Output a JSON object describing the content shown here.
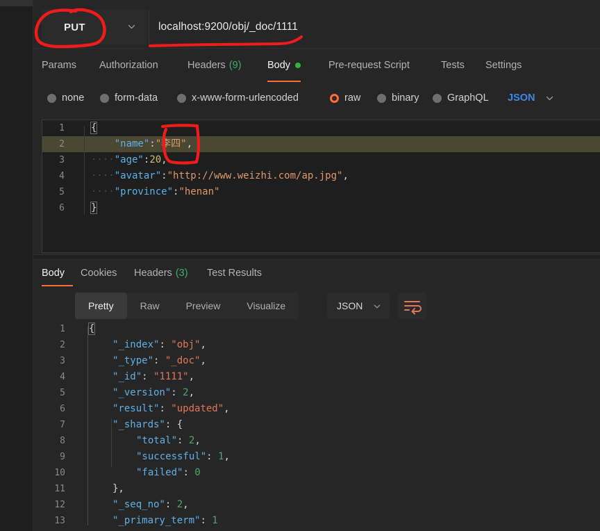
{
  "request": {
    "method": "PUT",
    "url": "localhost:9200/obj/_doc/1111",
    "tabs": [
      {
        "label": "Params",
        "count": null,
        "dot": false,
        "active": false
      },
      {
        "label": "Authorization",
        "count": null,
        "dot": false,
        "active": false
      },
      {
        "label": "Headers",
        "count": "(9)",
        "dot": false,
        "active": false
      },
      {
        "label": "Body",
        "count": null,
        "dot": true,
        "active": true
      },
      {
        "label": "Pre-request Script",
        "count": null,
        "dot": false,
        "active": false
      },
      {
        "label": "Tests",
        "count": null,
        "dot": false,
        "active": false
      },
      {
        "label": "Settings",
        "count": null,
        "dot": false,
        "active": false
      }
    ],
    "body_types": [
      {
        "label": "none",
        "selected": false
      },
      {
        "label": "form-data",
        "selected": false
      },
      {
        "label": "x-www-form-urlencoded",
        "selected": false
      },
      {
        "label": "raw",
        "selected": true
      },
      {
        "label": "binary",
        "selected": false
      },
      {
        "label": "GraphQL",
        "selected": false
      }
    ],
    "raw_format": "JSON",
    "editor": {
      "lines": [
        {
          "num": "1",
          "highlight": false,
          "tokens": [
            {
              "t": "{",
              "c": "brace"
            }
          ]
        },
        {
          "num": "2",
          "highlight": true,
          "tokens": [
            {
              "t": "····",
              "c": "ws"
            },
            {
              "t": "\"name\"",
              "c": "k"
            },
            {
              "t": ":",
              "c": "p"
            },
            {
              "t": "\"李四\"",
              "c": "s"
            },
            {
              "t": ",",
              "c": "p"
            }
          ]
        },
        {
          "num": "3",
          "highlight": false,
          "tokens": [
            {
              "t": "····",
              "c": "ws"
            },
            {
              "t": "\"age\"",
              "c": "k"
            },
            {
              "t": ":",
              "c": "p"
            },
            {
              "t": "20",
              "c": "n"
            },
            {
              "t": ",",
              "c": "p"
            }
          ]
        },
        {
          "num": "4",
          "highlight": false,
          "tokens": [
            {
              "t": "····",
              "c": "ws"
            },
            {
              "t": "\"avatar\"",
              "c": "k"
            },
            {
              "t": ":",
              "c": "p"
            },
            {
              "t": "\"http://www.weizhi.com/ap.jpg\"",
              "c": "s"
            },
            {
              "t": ",",
              "c": "p"
            }
          ]
        },
        {
          "num": "5",
          "highlight": false,
          "tokens": [
            {
              "t": "····",
              "c": "ws"
            },
            {
              "t": "\"province\"",
              "c": "k"
            },
            {
              "t": ":",
              "c": "p"
            },
            {
              "t": "\"henan\"",
              "c": "s"
            }
          ]
        },
        {
          "num": "6",
          "highlight": false,
          "tokens": [
            {
              "t": "}",
              "c": "brace"
            }
          ]
        }
      ]
    }
  },
  "response": {
    "tabs": [
      {
        "label": "Body",
        "count": null,
        "active": true
      },
      {
        "label": "Cookies",
        "count": null,
        "active": false
      },
      {
        "label": "Headers",
        "count": "(3)",
        "active": false
      },
      {
        "label": "Test Results",
        "count": null,
        "active": false
      }
    ],
    "view_modes": [
      {
        "label": "Pretty",
        "active": true
      },
      {
        "label": "Raw",
        "active": false
      },
      {
        "label": "Preview",
        "active": false
      },
      {
        "label": "Visualize",
        "active": false
      }
    ],
    "format": "JSON",
    "wrap_icon": "wrap-text-icon",
    "body": {
      "lines": [
        {
          "num": "1",
          "indent": 0,
          "tokens": [
            {
              "t": "{",
              "c": "rp"
            }
          ]
        },
        {
          "num": "2",
          "indent": 1,
          "tokens": [
            {
              "t": "\"_index\"",
              "c": "rk"
            },
            {
              "t": ": ",
              "c": "rp"
            },
            {
              "t": "\"obj\"",
              "c": "rs"
            },
            {
              "t": ",",
              "c": "rp"
            }
          ]
        },
        {
          "num": "3",
          "indent": 1,
          "tokens": [
            {
              "t": "\"_type\"",
              "c": "rk"
            },
            {
              "t": ": ",
              "c": "rp"
            },
            {
              "t": "\"_doc\"",
              "c": "rs"
            },
            {
              "t": ",",
              "c": "rp"
            }
          ]
        },
        {
          "num": "4",
          "indent": 1,
          "tokens": [
            {
              "t": "\"_id\"",
              "c": "rk"
            },
            {
              "t": ": ",
              "c": "rp"
            },
            {
              "t": "\"1111\"",
              "c": "rs"
            },
            {
              "t": ",",
              "c": "rp"
            }
          ]
        },
        {
          "num": "5",
          "indent": 1,
          "tokens": [
            {
              "t": "\"_version\"",
              "c": "rk"
            },
            {
              "t": ": ",
              "c": "rp"
            },
            {
              "t": "2",
              "c": "rn"
            },
            {
              "t": ",",
              "c": "rp"
            }
          ]
        },
        {
          "num": "6",
          "indent": 1,
          "tokens": [
            {
              "t": "\"result\"",
              "c": "rk"
            },
            {
              "t": ": ",
              "c": "rp"
            },
            {
              "t": "\"updated\"",
              "c": "rs"
            },
            {
              "t": ",",
              "c": "rp"
            }
          ]
        },
        {
          "num": "7",
          "indent": 1,
          "tokens": [
            {
              "t": "\"_shards\"",
              "c": "rk"
            },
            {
              "t": ": {",
              "c": "rp"
            }
          ]
        },
        {
          "num": "8",
          "indent": 2,
          "tokens": [
            {
              "t": "\"total\"",
              "c": "rk"
            },
            {
              "t": ": ",
              "c": "rp"
            },
            {
              "t": "2",
              "c": "rn"
            },
            {
              "t": ",",
              "c": "rp"
            }
          ]
        },
        {
          "num": "9",
          "indent": 2,
          "tokens": [
            {
              "t": "\"successful\"",
              "c": "rk"
            },
            {
              "t": ": ",
              "c": "rp"
            },
            {
              "t": "1",
              "c": "rn"
            },
            {
              "t": ",",
              "c": "rp"
            }
          ]
        },
        {
          "num": "10",
          "indent": 2,
          "tokens": [
            {
              "t": "\"failed\"",
              "c": "rk"
            },
            {
              "t": ": ",
              "c": "rp"
            },
            {
              "t": "0",
              "c": "rn"
            }
          ]
        },
        {
          "num": "11",
          "indent": 1,
          "tokens": [
            {
              "t": "},",
              "c": "rp"
            }
          ]
        },
        {
          "num": "12",
          "indent": 1,
          "tokens": [
            {
              "t": "\"_seq_no\"",
              "c": "rk"
            },
            {
              "t": ": ",
              "c": "rp"
            },
            {
              "t": "2",
              "c": "rn"
            },
            {
              "t": ",",
              "c": "rp"
            }
          ]
        },
        {
          "num": "13",
          "indent": 1,
          "tokens": [
            {
              "t": "\"_primary_term\"",
              "c": "rk"
            },
            {
              "t": ": ",
              "c": "rp"
            },
            {
              "t": "1",
              "c": "rn"
            }
          ]
        }
      ]
    }
  },
  "annotations": {
    "color": "#f01c1c",
    "marks": [
      {
        "name": "method-circle",
        "shape": "ellipse"
      },
      {
        "name": "url-underline",
        "shape": "underline"
      },
      {
        "name": "value-box",
        "shape": "box"
      }
    ]
  }
}
